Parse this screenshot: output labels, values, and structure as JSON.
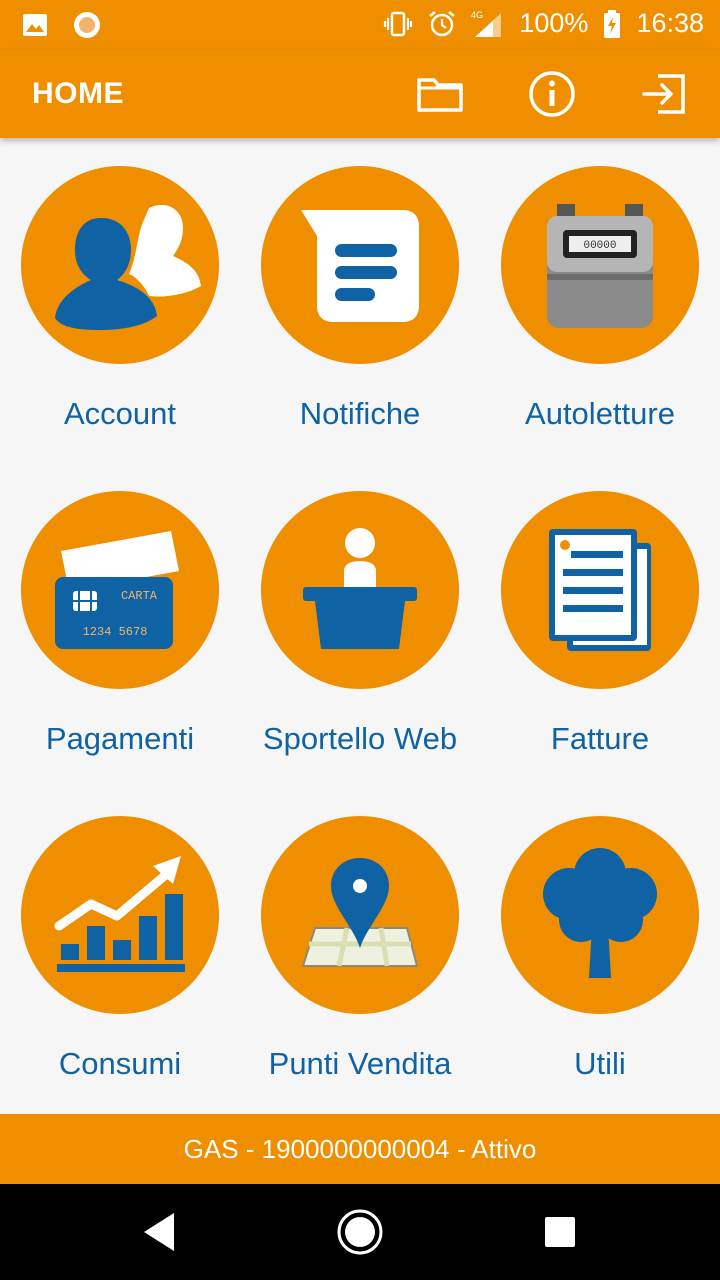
{
  "status_bar": {
    "battery": "100%",
    "time": "16:38",
    "network": "4G",
    "icons": [
      "gallery-icon",
      "record-icon",
      "vibrate-icon",
      "alarm-icon",
      "signal-icon",
      "battery-charging-icon"
    ]
  },
  "app_bar": {
    "title": "HOME",
    "actions": [
      "folder-icon",
      "info-icon",
      "logout-icon"
    ]
  },
  "menu": [
    {
      "label": "Account",
      "icon": "account-icon"
    },
    {
      "label": "Notifiche",
      "icon": "notification-icon"
    },
    {
      "label": "Autoletture",
      "icon": "gas-meter-icon"
    },
    {
      "label": "Pagamenti",
      "icon": "credit-card-icon"
    },
    {
      "label": "Sportello Web",
      "icon": "help-desk-icon"
    },
    {
      "label": "Fatture",
      "icon": "invoice-icon"
    },
    {
      "label": "Consumi",
      "icon": "chart-icon"
    },
    {
      "label": "Punti Vendita",
      "icon": "map-pin-icon"
    },
    {
      "label": "Utili",
      "icon": "tree-icon"
    }
  ],
  "card": {
    "brand": "CARTA",
    "number": "1234 5678"
  },
  "meter_display": "00000",
  "footer": {
    "contract_text": "GAS - 1900000000004 - Attivo"
  },
  "colors": {
    "primary": "#ef8f00",
    "accent_blue": "#0f62a3",
    "background": "#f6f6f6"
  }
}
